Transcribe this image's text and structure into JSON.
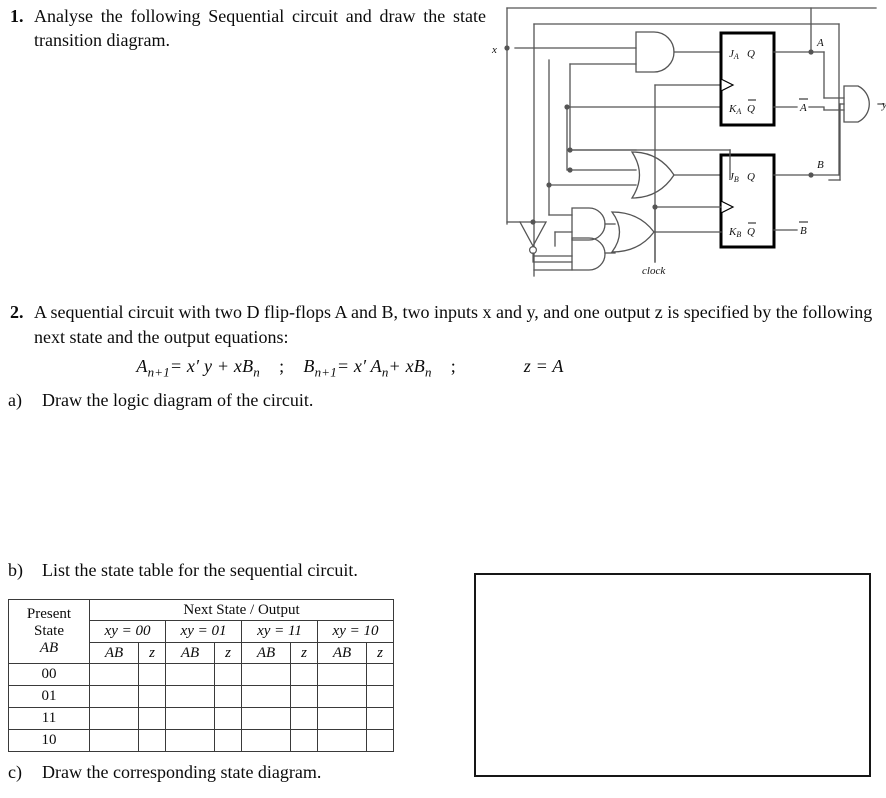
{
  "questions": {
    "q1": {
      "number": "1.",
      "text": "Analyse the following Sequential circuit and draw the state transition diagram."
    },
    "q2": {
      "number": "2.",
      "text": "A sequential circuit with two D flip-flops A and B, two inputs x and y, and one output z is specified by the following next state and the output equations:",
      "equations": {
        "eq1_lhs": "A",
        "eq1_sub": "n+1",
        "eq1_rhs": "= x′ y + xB",
        "eq1_rhs_sub": "n",
        "sep1": ";",
        "eq2_lhs": "B",
        "eq2_sub": "n+1",
        "eq2_rhs_a": "= x′ A",
        "eq2_rhs_a_sub": "n",
        "eq2_rhs_b": "+ xB",
        "eq2_rhs_b_sub": "n",
        "sep2": ";",
        "eq3": "z = A"
      },
      "sub_items": {
        "a": {
          "label": "a)",
          "text": "Draw the logic diagram of the circuit."
        },
        "b": {
          "label": "b)",
          "text": "List the state table for the sequential circuit."
        },
        "c": {
          "label": "c)",
          "text": "Draw the corresponding state diagram."
        }
      }
    }
  },
  "state_table": {
    "present_state_header": {
      "line1": "Present",
      "line2": "State",
      "line3": "AB"
    },
    "next_state_header": "Next State / Output",
    "input_groups": [
      "xy = 00",
      "xy = 01",
      "xy = 11",
      "xy = 10"
    ],
    "sub_headers": [
      "AB",
      "z"
    ],
    "rows": [
      {
        "present": "00",
        "cells": [
          "",
          "",
          "",
          "",
          "",
          "",
          "",
          ""
        ]
      },
      {
        "present": "01",
        "cells": [
          "",
          "",
          "",
          "",
          "",
          "",
          "",
          ""
        ]
      },
      {
        "present": "11",
        "cells": [
          "",
          "",
          "",
          "",
          "",
          "",
          "",
          ""
        ]
      },
      {
        "present": "10",
        "cells": [
          "",
          "",
          "",
          "",
          "",
          "",
          "",
          ""
        ]
      }
    ]
  },
  "answer_box": {
    "content": "",
    "border_color": "#161616"
  },
  "circuit": {
    "title": "JK flip-flop sequential circuit",
    "input_labels": {
      "x": "x",
      "clock": "clock"
    },
    "output_labels": {
      "y": "y"
    },
    "flipflop_a": {
      "j": "J",
      "j_sub": "A",
      "k": "K",
      "k_sub": "A",
      "q": "Q",
      "qbar": "Q̅",
      "out_q": "A",
      "out_qbar": "A̅"
    },
    "flipflop_b": {
      "j": "J",
      "j_sub": "B",
      "k": "K",
      "k_sub": "B",
      "q": "Q",
      "qbar": "Q̅",
      "out_q": "B",
      "out_qbar": "B̅"
    },
    "gates": [
      "and-gate-ja",
      "or-gate-jb",
      "and-gate-kb-1",
      "and-gate-kb-2",
      "or-gate-kb",
      "not-gate-x",
      "and-gate-y"
    ],
    "line_color": "#555555",
    "box_color": "#000000"
  }
}
